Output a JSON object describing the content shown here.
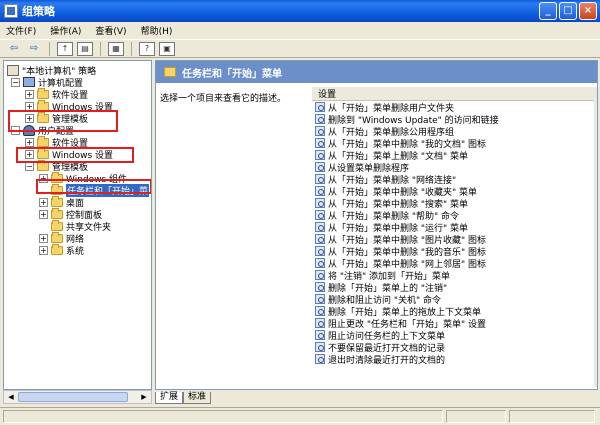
{
  "window": {
    "title": "组策略"
  },
  "menu": [
    {
      "label": "文件(F)"
    },
    {
      "label": "操作(A)"
    },
    {
      "label": "查看(V)"
    },
    {
      "label": "帮助(H)"
    }
  ],
  "toolbar": {
    "back_icon": "back-arrow-icon",
    "forward_icon": "forward-arrow-icon"
  },
  "tree": {
    "items": [
      {
        "label": "\"本地计算机\" 策略",
        "icon": "policy-icon",
        "expander": ""
      },
      {
        "label": "计算机配置",
        "icon": "computer-icon",
        "expander": "−"
      },
      {
        "label": "软件设置",
        "icon": "folder-icon",
        "expander": "+"
      },
      {
        "label": "Windows 设置",
        "icon": "folder-icon",
        "expander": "+"
      },
      {
        "label": "管理模板",
        "icon": "folder-icon",
        "expander": "+"
      },
      {
        "label": "用户配置",
        "icon": "user-icon",
        "expander": "−"
      },
      {
        "label": "软件设置",
        "icon": "folder-icon",
        "expander": "+"
      },
      {
        "label": "Windows 设置",
        "icon": "folder-icon",
        "expander": "+"
      },
      {
        "label": "管理模板",
        "icon": "folder-icon",
        "expander": "−"
      },
      {
        "label": "Windows 组件",
        "icon": "folder-icon",
        "expander": "+"
      },
      {
        "label": "任务栏和「开始」菜",
        "icon": "folder-icon",
        "expander": ""
      },
      {
        "label": "桌面",
        "icon": "folder-icon",
        "expander": "+"
      },
      {
        "label": "控制面板",
        "icon": "folder-icon",
        "expander": "+"
      },
      {
        "label": "共享文件夹",
        "icon": "folder-icon",
        "expander": ""
      },
      {
        "label": "网络",
        "icon": "folder-icon",
        "expander": "+"
      },
      {
        "label": "系统",
        "icon": "folder-icon",
        "expander": "+"
      }
    ]
  },
  "right": {
    "header": "任务栏和「开始」菜单",
    "description": "选择一个项目来查看它的描述。",
    "column_header": "设置",
    "settings": [
      "从「开始」菜单删除用户文件夹",
      "删除到 \"Windows Update\" 的访问和链接",
      "从「开始」菜单删除公用程序组",
      "从「开始」菜单中删除 \"我的文档\" 图标",
      "从「开始」菜单上删除 \"文档\" 菜单",
      "从设置菜单删除程序",
      "从「开始」菜单删除 \"网络连接\"",
      "从「开始」菜单中删除 \"收藏夹\" 菜单",
      "从「开始」菜单中删除 \"搜索\" 菜单",
      "从「开始」菜单删除 \"帮助\" 命令",
      "从「开始」菜单中删除 \"运行\" 菜单",
      "从「开始」菜单中删除 \"图片收藏\" 图标",
      "从「开始」菜单中删除 \"我的音乐\" 图标",
      "从「开始」菜单中删除 \"网上邻居\" 图标",
      "将 \"注销\" 添加到「开始」菜单",
      "删除「开始」菜单上的 \"注销\"",
      "删除和阻止访问 \"关机\" 命令",
      "删除「开始」菜单上的拖放上下文菜单",
      "阻止更改 \"任务栏和「开始」菜单\" 设置",
      "阻止访问任务栏的上下文菜单",
      "不要保留最近打开文档的记录",
      "退出时清除最近打开的文档的"
    ]
  },
  "tabs": [
    {
      "label": "扩展"
    },
    {
      "label": "标准"
    }
  ],
  "colors": {
    "highlight": "#E02020",
    "selection": "#316AC5",
    "header": "#6C8EC9"
  }
}
